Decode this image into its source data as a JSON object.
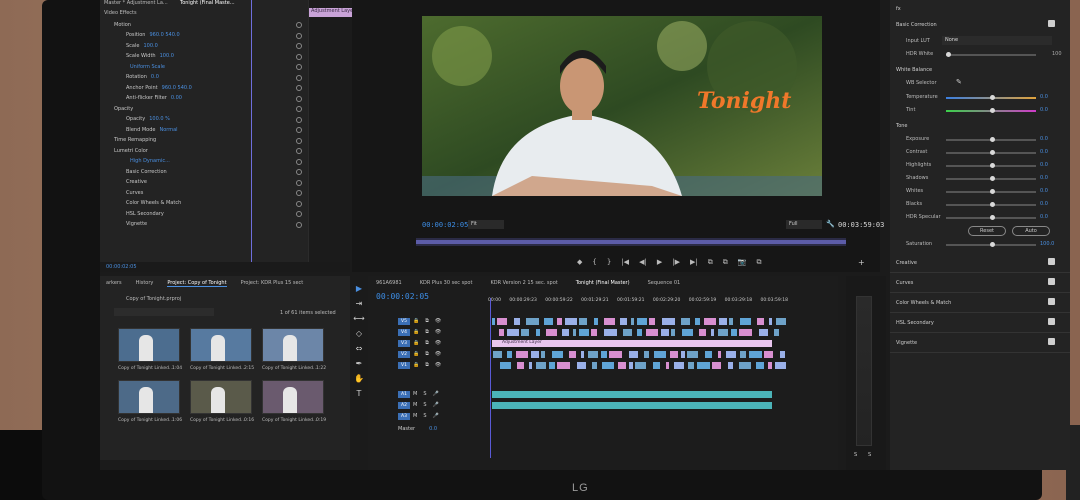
{
  "effect_controls": {
    "source": "Master * Adjustment La...",
    "sequence": "Tonight (Final Maste...",
    "clip_label": "Adjustment Layer",
    "section": "Video Effects",
    "rows": [
      {
        "label": "Motion",
        "value": ""
      },
      {
        "label": "Position",
        "value": "960.0   540.0"
      },
      {
        "label": "Scale",
        "value": "100.0"
      },
      {
        "label": "Scale Width",
        "value": "100.0"
      },
      {
        "label": "",
        "value": "Uniform Scale"
      },
      {
        "label": "Rotation",
        "value": "0.0"
      },
      {
        "label": "Anchor Point",
        "value": "960.0   540.0"
      },
      {
        "label": "Anti-flicker Filter",
        "value": "0.00"
      },
      {
        "label": "Opacity",
        "value": ""
      },
      {
        "label": "Opacity",
        "value": "100.0 %"
      },
      {
        "label": "Blend Mode",
        "value": "Normal"
      },
      {
        "label": "Time Remapping",
        "value": ""
      },
      {
        "label": "Lumetri Color",
        "value": ""
      },
      {
        "label": "",
        "value": "High Dynamic..."
      },
      {
        "label": "Basic Correction",
        "value": ""
      },
      {
        "label": "Creative",
        "value": ""
      },
      {
        "label": "Curves",
        "value": ""
      },
      {
        "label": "Color Wheels & Match",
        "value": ""
      },
      {
        "label": "HSL Secondary",
        "value": ""
      },
      {
        "label": "Vignette",
        "value": ""
      }
    ],
    "timecode": "00:00:02:05"
  },
  "program_monitor": {
    "overlay_text": "Tonight",
    "timecode_current": "00:00:02:05",
    "timecode_end": "00:03:59:03",
    "fit_label": "Fit",
    "resolution_label": "Full",
    "controls": [
      "◆",
      "{",
      "}",
      "|◀",
      "◀|",
      "▶",
      "|▶",
      "▶|",
      "⧉",
      "⧉",
      "📷",
      "⧉"
    ]
  },
  "lumetri": {
    "basic_correction": "Basic Correction",
    "input_lut_label": "Input LUT",
    "input_lut_value": "None",
    "hdr_white_label": "HDR White",
    "hdr_white_value": "100",
    "white_balance": "White Balance",
    "wb_selector": "WB Selector",
    "temperature_label": "Temperature",
    "temperature_value": "0.0",
    "tint_label": "Tint",
    "tint_value": "0.0",
    "tone": "Tone",
    "tone_rows": [
      {
        "label": "Exposure",
        "value": "0.0"
      },
      {
        "label": "Contrast",
        "value": "0.0"
      },
      {
        "label": "Highlights",
        "value": "0.0"
      },
      {
        "label": "Shadows",
        "value": "0.0"
      },
      {
        "label": "Whites",
        "value": "0.0"
      },
      {
        "label": "Blacks",
        "value": "0.0"
      },
      {
        "label": "HDR Specular",
        "value": "0.0"
      }
    ],
    "reset_label": "Reset",
    "auto_label": "Auto",
    "saturation_label": "Saturation",
    "saturation_value": "100.0",
    "sections": [
      "Creative",
      "Curves",
      "Color Wheels & Match",
      "HSL Secondary",
      "Vignette"
    ]
  },
  "project": {
    "tabs": [
      "arkers",
      "History",
      "Project: Copy of Tonight",
      "Project: KDR Plus 15 sect"
    ],
    "file": "Copy of Tonight.prproj",
    "count": "1 of 61 items selected",
    "clips": [
      {
        "name": "Copy of Tonight Linked...",
        "dur": "1:04"
      },
      {
        "name": "Copy of Tonight Linked...",
        "dur": "2:15"
      },
      {
        "name": "Copy of Tonight Linked...",
        "dur": "1:22"
      },
      {
        "name": "Copy of Tonight Linked...",
        "dur": "1:06"
      },
      {
        "name": "Copy of Tonight Linked...",
        "dur": "0:16"
      },
      {
        "name": "Copy of Tonight Linked...",
        "dur": "0:19"
      }
    ]
  },
  "timeline": {
    "tabs": [
      "961A6981",
      "KDR Plus 30 sec spot",
      "KDR Version 2 15 sec. spot",
      "Tonight (Final Master)",
      "Sequence 01"
    ],
    "timecode": "00:00:02:05",
    "ruler": [
      "00:00",
      "00:00:29:23",
      "00:00:59:22",
      "00:01:29:21",
      "00:01:59:21",
      "00:02:29:20",
      "00:02:59:19",
      "00:03:29:18",
      "00:03:59:18"
    ],
    "tracks": [
      {
        "name": "V5"
      },
      {
        "name": "V4"
      },
      {
        "name": "V3"
      },
      {
        "name": "V2"
      },
      {
        "name": "V1"
      },
      {
        "name": "A1"
      },
      {
        "name": "A2"
      },
      {
        "name": "A3"
      }
    ],
    "adjustment_clip": "Adjustment Layer",
    "master_label": "Master",
    "master_value": "0.0"
  },
  "monitor_brand": "LG",
  "colors": {
    "accent": "#4a8fe0",
    "clip_blue": "#5fa4d6",
    "clip_pink": "#d88fd0",
    "audio_teal": "#4bb3b8"
  }
}
